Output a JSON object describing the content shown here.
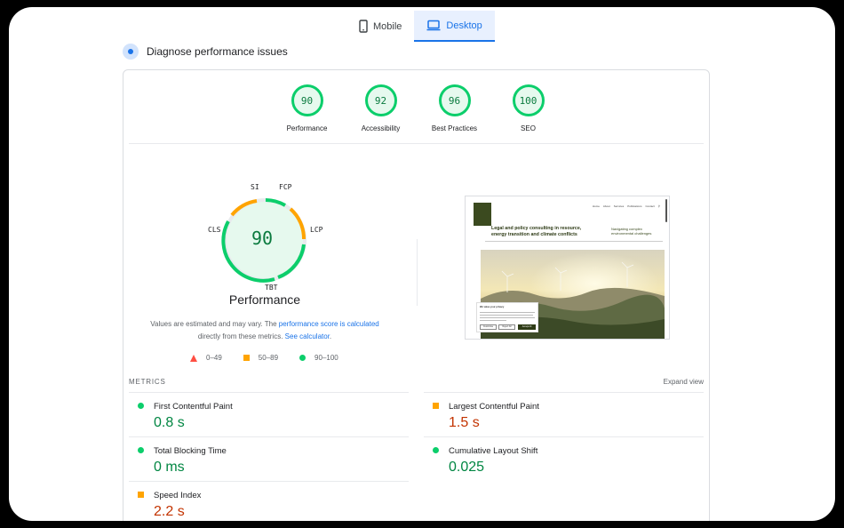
{
  "tabs": [
    {
      "label": "Mobile",
      "icon": "phone-icon",
      "active": false
    },
    {
      "label": "Desktop",
      "icon": "laptop-icon",
      "active": true
    }
  ],
  "diagnose_label": "Diagnose performance issues",
  "scores": [
    {
      "value": "90",
      "label": "Performance"
    },
    {
      "value": "92",
      "label": "Accessibility"
    },
    {
      "value": "96",
      "label": "Best Practices"
    },
    {
      "value": "100",
      "label": "SEO"
    }
  ],
  "performance": {
    "score": "90",
    "title": "Performance",
    "segments": {
      "SI": "SI",
      "FCP": "FCP",
      "LCP": "LCP",
      "TBT": "TBT",
      "CLS": "CLS"
    },
    "note_prefix": "Values are estimated and may vary. The ",
    "note_link1": "performance score is calculated",
    "note_mid": "directly from these metrics. ",
    "note_link2": "See calculator",
    "note_suffix": "."
  },
  "legend": [
    {
      "range": "0–49",
      "shape": "triangle",
      "color": "#ff4e42"
    },
    {
      "range": "50–89",
      "shape": "square",
      "color": "#ffa400"
    },
    {
      "range": "90–100",
      "shape": "circle",
      "color": "#0cce6b"
    }
  ],
  "thumbnail": {
    "headline": "Legal and policy consulting in resource, energy transition and climate conflicts",
    "subheading": "Navigating complex environmental challenges",
    "nav": [
      "Home",
      "About",
      "Services",
      "Publications",
      "Contact"
    ],
    "cookie_title": "We value your privacy",
    "cookie_buttons": [
      "Customise",
      "Reject All",
      "Accept All"
    ]
  },
  "metrics_heading": "METRICS",
  "expand_label": "Expand view",
  "metrics": [
    {
      "name": "First Contentful Paint",
      "value": "0.8 s",
      "status": "good"
    },
    {
      "name": "Largest Contentful Paint",
      "value": "1.5 s",
      "status": "average"
    },
    {
      "name": "Total Blocking Time",
      "value": "0 ms",
      "status": "good"
    },
    {
      "name": "Cumulative Layout Shift",
      "value": "0.025",
      "status": "good"
    },
    {
      "name": "Speed Index",
      "value": "2.2 s",
      "status": "average"
    }
  ],
  "colors": {
    "good": "#0cce6b",
    "average": "#ffa400",
    "poor": "#ff4e42",
    "accent": "#1a73e8"
  }
}
